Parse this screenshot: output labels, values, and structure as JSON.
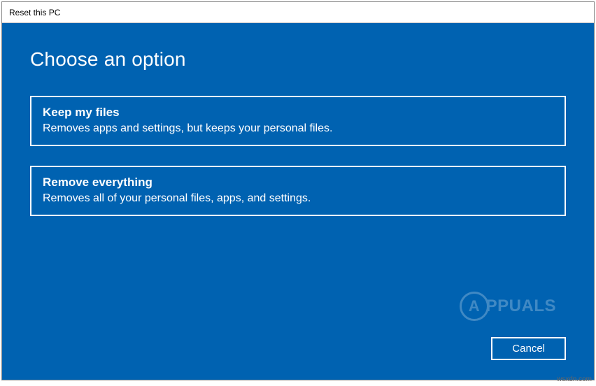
{
  "window": {
    "title": "Reset this PC"
  },
  "heading": "Choose an option",
  "options": [
    {
      "title": "Keep my files",
      "description": "Removes apps and settings, but keeps your personal files."
    },
    {
      "title": "Remove everything",
      "description": "Removes all of your personal files, apps, and settings."
    }
  ],
  "buttons": {
    "cancel": "Cancel"
  },
  "watermark": {
    "circle": "A",
    "text": "PPUALS"
  },
  "attribution": "wsxdn.com"
}
